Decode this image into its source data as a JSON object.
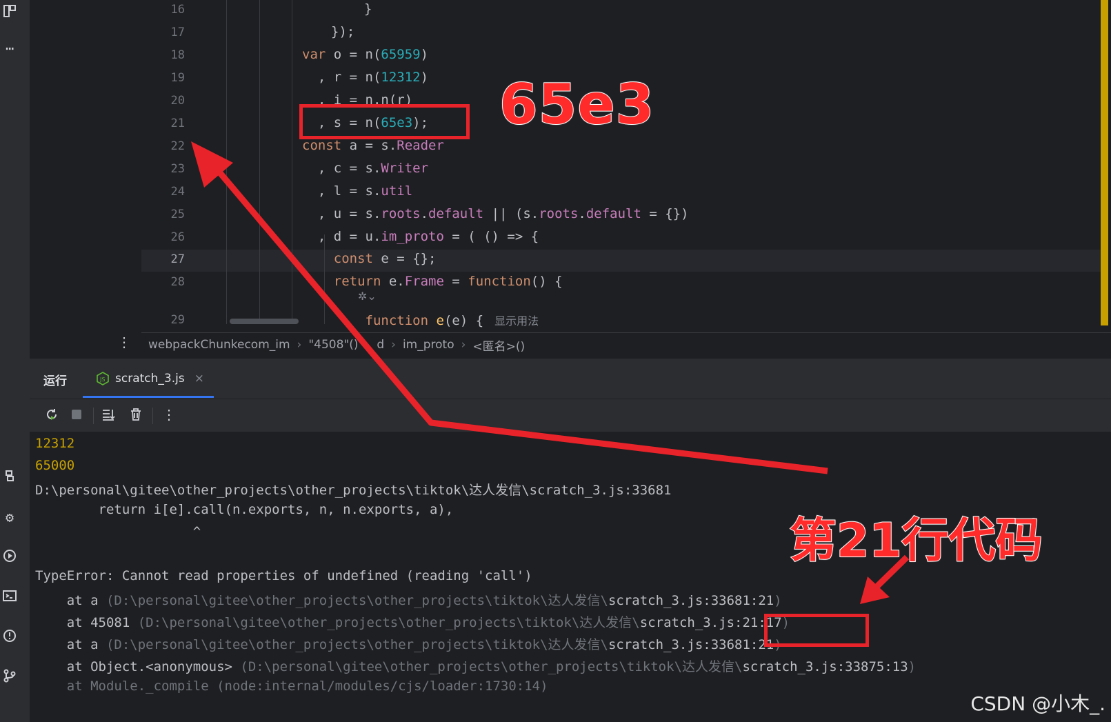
{
  "editor": {
    "lines": [
      {
        "num": "16",
        "segments": [
          {
            "t": "}",
            "c": ""
          }
        ]
      },
      {
        "num": "17",
        "segments": [
          {
            "t": "});",
            "c": ""
          }
        ]
      },
      {
        "num": "18",
        "segments": [
          {
            "t": "var",
            "c": "kw"
          },
          {
            "t": " o = n(",
            "c": ""
          },
          {
            "t": "65959",
            "c": "num"
          },
          {
            "t": ")",
            "c": ""
          }
        ]
      },
      {
        "num": "19",
        "segments": [
          {
            "t": "  , r = n(",
            "c": ""
          },
          {
            "t": "12312",
            "c": "num"
          },
          {
            "t": ")",
            "c": ""
          }
        ]
      },
      {
        "num": "20",
        "segments": [
          {
            "t": "  , i = n.n(r)",
            "c": ""
          }
        ]
      },
      {
        "num": "21",
        "segments": [
          {
            "t": "  , s = n(",
            "c": ""
          },
          {
            "t": "65e3",
            "c": "num"
          },
          {
            "t": ");",
            "c": ""
          }
        ]
      },
      {
        "num": "22",
        "segments": [
          {
            "t": "const",
            "c": "kw"
          },
          {
            "t": " a = s.",
            "c": ""
          },
          {
            "t": "Reader",
            "c": "prop"
          }
        ]
      },
      {
        "num": "23",
        "segments": [
          {
            "t": "  , c = s.",
            "c": ""
          },
          {
            "t": "Writer",
            "c": "prop"
          }
        ]
      },
      {
        "num": "24",
        "segments": [
          {
            "t": "  , l = s.",
            "c": ""
          },
          {
            "t": "util",
            "c": "prop"
          }
        ]
      },
      {
        "num": "25",
        "segments": [
          {
            "t": "  , u = s.",
            "c": ""
          },
          {
            "t": "roots",
            "c": "prop"
          },
          {
            "t": ".",
            "c": ""
          },
          {
            "t": "default",
            "c": "prop"
          },
          {
            "t": " || (s.",
            "c": ""
          },
          {
            "t": "roots",
            "c": "prop"
          },
          {
            "t": ".",
            "c": ""
          },
          {
            "t": "default",
            "c": "prop"
          },
          {
            "t": " = {})",
            "c": ""
          }
        ]
      },
      {
        "num": "26",
        "segments": [
          {
            "t": "  , d = u.",
            "c": ""
          },
          {
            "t": "im_proto",
            "c": "prop"
          },
          {
            "t": " = ( () => {",
            "c": ""
          }
        ]
      },
      {
        "num": "27",
        "segments": [
          {
            "t": "    ",
            "c": ""
          },
          {
            "t": "const",
            "c": "kw"
          },
          {
            "t": " e = {};",
            "c": ""
          }
        ]
      },
      {
        "num": "28",
        "segments": [
          {
            "t": "    ",
            "c": ""
          },
          {
            "t": "return",
            "c": "kw"
          },
          {
            "t": " e.",
            "c": ""
          },
          {
            "t": "Frame",
            "c": "prop"
          },
          {
            "t": " = ",
            "c": ""
          },
          {
            "t": "function",
            "c": "kw"
          },
          {
            "t": "() {",
            "c": ""
          }
        ]
      },
      {
        "num": "29",
        "segments": [
          {
            "t": "        ",
            "c": ""
          },
          {
            "t": "function",
            "c": "kw"
          },
          {
            "t": " ",
            "c": ""
          },
          {
            "t": "e",
            "c": "fname"
          },
          {
            "t": "(e) {",
            "c": ""
          }
        ]
      }
    ],
    "current_line": "27",
    "inlay_hint": "显示用法"
  },
  "breadcrumb": [
    "webpackChunkecom_im",
    "\"4508\"()",
    "d",
    "im_proto",
    "<匿名>()"
  ],
  "run_panel": {
    "title": "运行",
    "tab_label": "scratch_3.js",
    "tab_close": "×"
  },
  "console": {
    "lines": [
      {
        "text": "12312",
        "style": "yellow"
      },
      {
        "text": "65000",
        "style": "yellow"
      },
      {
        "text": "D:\\personal\\gitee\\other_projects\\other_projects\\tiktok\\达人发信\\scratch_3.js:33681",
        "style": ""
      },
      {
        "text": "        return i[e].call(n.exports, n, n.exports, a),",
        "style": ""
      },
      {
        "text": "                    ^",
        "style": ""
      },
      {
        "text": "",
        "style": ""
      },
      {
        "text": "TypeError: Cannot read properties of undefined (reading 'call')",
        "style": ""
      },
      {
        "prefix": "    at a ",
        "dim": "(D:\\personal\\gitee\\other_projects\\other_projects\\tiktok\\达人发信\\",
        "tail": "scratch_3.js:33681:21",
        "end": ")"
      },
      {
        "prefix": "    at 45081 ",
        "dim": "(D:\\personal\\gitee\\other_projects\\other_projects\\tiktok\\达人发信\\",
        "tail": "scratch_3.js:21:17",
        "end": ")"
      },
      {
        "prefix": "    at a ",
        "dim": "(D:\\personal\\gitee\\other_projects\\other_projects\\tiktok\\达人发信\\",
        "tail": "scratch_3.js:33681:21",
        "end": ")"
      },
      {
        "prefix": "    at Object.<anonymous> ",
        "dim": "(D:\\personal\\gitee\\other_projects\\other_projects\\tiktok\\达人发信\\",
        "tail": "scratch_3.js:33875:13",
        "end": ")"
      },
      {
        "text": "    at Module._compile (node:internal/modules/cjs/loader:1730:14)",
        "style": "dimall"
      }
    ]
  },
  "annotations": {
    "label_65e3": "65e3",
    "label_line21": "第21行代码",
    "color": "#e8232a"
  },
  "watermark": "CSDN @小木_.",
  "icons": [
    "project-icon",
    "more-icon",
    "python-icon",
    "settings-icon",
    "run-icon",
    "terminal-icon",
    "problems-icon",
    "git-icon",
    "rerun-icon",
    "stop-icon",
    "scroll-to-end-icon",
    "trash-icon",
    "kebab-menu-icon",
    "nodejs-icon",
    "ai-assist-icon"
  ]
}
